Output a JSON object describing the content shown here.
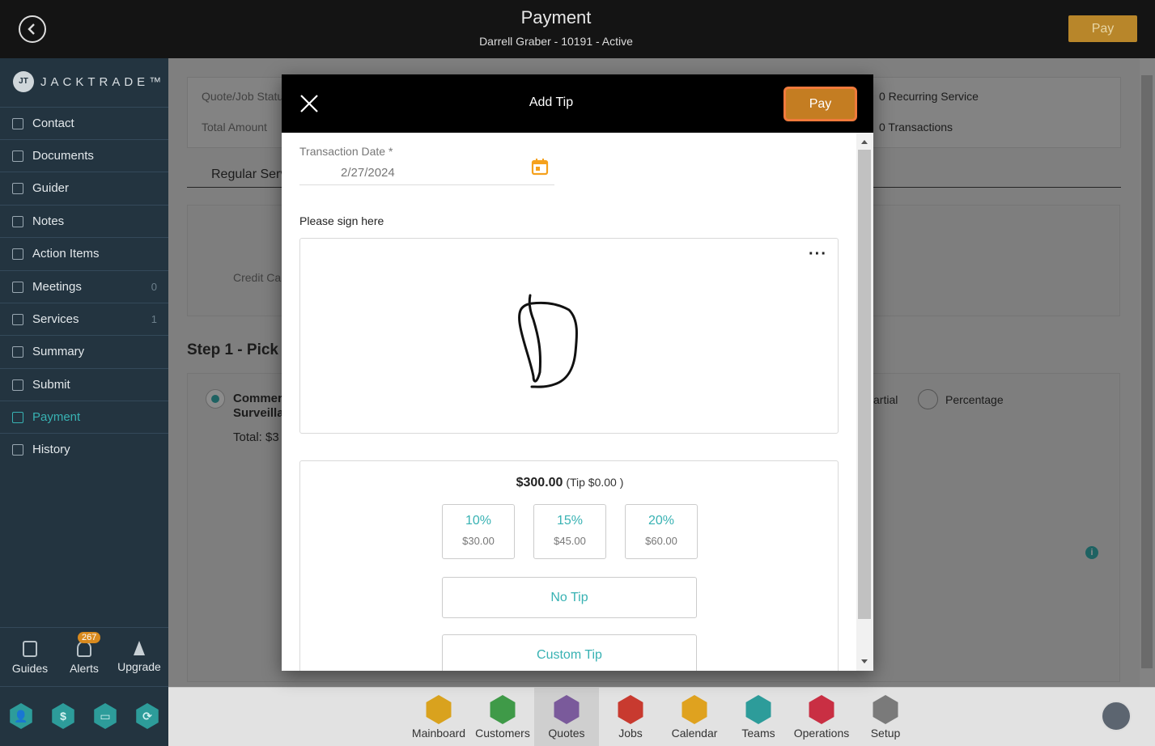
{
  "topbar": {
    "title": "Payment",
    "subtitle": "Darrell Graber - 10191 - Active",
    "pay_label": "Pay"
  },
  "brand": {
    "name": "JACKTRADE™",
    "mark": "JT"
  },
  "sidebar": {
    "items": [
      {
        "label": "Contact",
        "count": ""
      },
      {
        "label": "Documents",
        "count": ""
      },
      {
        "label": "Guider",
        "count": ""
      },
      {
        "label": "Notes",
        "count": ""
      },
      {
        "label": "Action Items",
        "count": ""
      },
      {
        "label": "Meetings",
        "count": "0"
      },
      {
        "label": "Services",
        "count": "1"
      },
      {
        "label": "Summary",
        "count": ""
      },
      {
        "label": "Submit",
        "count": ""
      },
      {
        "label": "Payment",
        "count": ""
      },
      {
        "label": "History",
        "count": ""
      }
    ],
    "active": "Payment",
    "bottom": {
      "guides": "Guides",
      "alerts": "Alerts",
      "alerts_count": "267",
      "upgrade": "Upgrade"
    }
  },
  "background": {
    "quote_status_label": "Quote/Job Status",
    "total_amount_label": "Total Amount",
    "recurring_service": "0 Recurring Service",
    "transactions": "0 Transactions",
    "tab_regular": "Regular Serv",
    "credit_card": "Credit Car",
    "step1": "Step 1 - Pick",
    "service_line1": "Commer",
    "service_line2": "Surveilla",
    "total": "Total: $3",
    "partial": "artial",
    "percentage": "Percentage"
  },
  "bottom_nav": [
    {
      "label": "Mainboard",
      "color": "#d9a21e"
    },
    {
      "label": "Customers",
      "color": "#3f9a48"
    },
    {
      "label": "Quotes",
      "color": "#7a5a9b"
    },
    {
      "label": "Jobs",
      "color": "#c83a2f"
    },
    {
      "label": "Calendar",
      "color": "#dfa21f"
    },
    {
      "label": "Teams",
      "color": "#2d9c9a"
    },
    {
      "label": "Operations",
      "color": "#c92f43"
    },
    {
      "label": "Setup",
      "color": "#7a7a7a"
    }
  ],
  "bottom_nav_active": "Quotes",
  "modal": {
    "title": "Add Tip",
    "pay_label": "Pay",
    "transaction_date_label": "Transaction Date *",
    "transaction_date_value": "2/27/2024",
    "sign_label": "Please sign here",
    "tip_total": "$300.00",
    "tip_note": "(Tip $0.00 )",
    "tip_options": [
      {
        "pct": "10%",
        "amount": "$30.00"
      },
      {
        "pct": "15%",
        "amount": "$45.00"
      },
      {
        "pct": "20%",
        "amount": "$60.00"
      }
    ],
    "no_tip": "No Tip",
    "custom_tip": "Custom Tip"
  },
  "colors": {
    "accent": "#38b2b3",
    "pay": "#c47d22",
    "sidebar": "#233440"
  }
}
